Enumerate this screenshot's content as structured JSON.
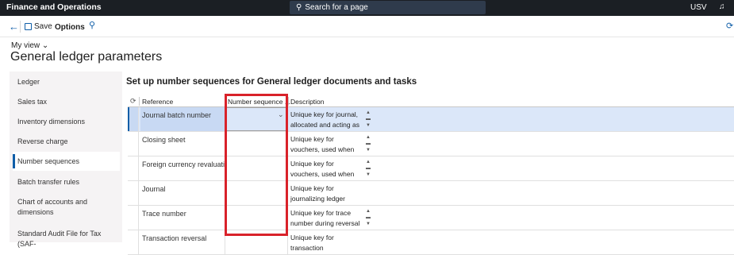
{
  "topbar": {
    "app_title": "Finance and Operations",
    "search_placeholder": "Search for a page",
    "company": "USV"
  },
  "actionbar": {
    "save_label": "Save",
    "options_label": "Options"
  },
  "header": {
    "my_view": "My view",
    "title": "General ledger parameters"
  },
  "leftnav": {
    "items": [
      {
        "label": "Ledger"
      },
      {
        "label": "Sales tax"
      },
      {
        "label": "Inventory dimensions"
      },
      {
        "label": "Reverse charge"
      },
      {
        "label": "Number sequences",
        "selected": true
      },
      {
        "label": "Batch transfer rules"
      },
      {
        "label": "Chart of accounts and dimensions"
      },
      {
        "label": "Standard Audit File for Tax (SAF-"
      }
    ]
  },
  "section": {
    "title": "Set up number sequences for General ledger documents and tasks"
  },
  "grid": {
    "columns": [
      "Reference",
      "Number sequence ...",
      "Description"
    ],
    "rows": [
      {
        "reference": "Journal batch number",
        "number_sequence": "",
        "description": "Unique key for journal, allocated and acting as",
        "selected": true
      },
      {
        "reference": "Closing sheet",
        "number_sequence": "",
        "description": "Unique key for vouchers, used when posting to"
      },
      {
        "reference": "Foreign currency revaluati...",
        "number_sequence": "",
        "description": "Unique key for vouchers, used when posting"
      },
      {
        "reference": "Journal",
        "number_sequence": "",
        "description": "Unique key for journalizing ledger transactions"
      },
      {
        "reference": "Trace number",
        "number_sequence": "",
        "description": "Unique key for trace number during reversal"
      },
      {
        "reference": "Transaction reversal",
        "number_sequence": "",
        "description": "Unique key for transaction"
      }
    ]
  },
  "colors": {
    "topbar_bg": "#1b1f24",
    "accent": "#0f5ea8",
    "selected_row": "#dbe7f9",
    "highlight": "#d9222a"
  }
}
